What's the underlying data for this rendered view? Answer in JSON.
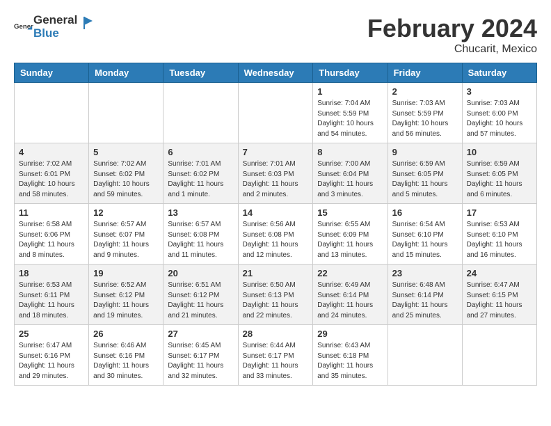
{
  "header": {
    "logo_general": "General",
    "logo_blue": "Blue",
    "month_year": "February 2024",
    "location": "Chucarit, Mexico"
  },
  "weekdays": [
    "Sunday",
    "Monday",
    "Tuesday",
    "Wednesday",
    "Thursday",
    "Friday",
    "Saturday"
  ],
  "weeks": [
    [
      {
        "day": "",
        "info": ""
      },
      {
        "day": "",
        "info": ""
      },
      {
        "day": "",
        "info": ""
      },
      {
        "day": "",
        "info": ""
      },
      {
        "day": "1",
        "info": "Sunrise: 7:04 AM\nSunset: 5:59 PM\nDaylight: 10 hours and 54 minutes."
      },
      {
        "day": "2",
        "info": "Sunrise: 7:03 AM\nSunset: 5:59 PM\nDaylight: 10 hours and 56 minutes."
      },
      {
        "day": "3",
        "info": "Sunrise: 7:03 AM\nSunset: 6:00 PM\nDaylight: 10 hours and 57 minutes."
      }
    ],
    [
      {
        "day": "4",
        "info": "Sunrise: 7:02 AM\nSunset: 6:01 PM\nDaylight: 10 hours and 58 minutes."
      },
      {
        "day": "5",
        "info": "Sunrise: 7:02 AM\nSunset: 6:02 PM\nDaylight: 10 hours and 59 minutes."
      },
      {
        "day": "6",
        "info": "Sunrise: 7:01 AM\nSunset: 6:02 PM\nDaylight: 11 hours and 1 minute."
      },
      {
        "day": "7",
        "info": "Sunrise: 7:01 AM\nSunset: 6:03 PM\nDaylight: 11 hours and 2 minutes."
      },
      {
        "day": "8",
        "info": "Sunrise: 7:00 AM\nSunset: 6:04 PM\nDaylight: 11 hours and 3 minutes."
      },
      {
        "day": "9",
        "info": "Sunrise: 6:59 AM\nSunset: 6:05 PM\nDaylight: 11 hours and 5 minutes."
      },
      {
        "day": "10",
        "info": "Sunrise: 6:59 AM\nSunset: 6:05 PM\nDaylight: 11 hours and 6 minutes."
      }
    ],
    [
      {
        "day": "11",
        "info": "Sunrise: 6:58 AM\nSunset: 6:06 PM\nDaylight: 11 hours and 8 minutes."
      },
      {
        "day": "12",
        "info": "Sunrise: 6:57 AM\nSunset: 6:07 PM\nDaylight: 11 hours and 9 minutes."
      },
      {
        "day": "13",
        "info": "Sunrise: 6:57 AM\nSunset: 6:08 PM\nDaylight: 11 hours and 11 minutes."
      },
      {
        "day": "14",
        "info": "Sunrise: 6:56 AM\nSunset: 6:08 PM\nDaylight: 11 hours and 12 minutes."
      },
      {
        "day": "15",
        "info": "Sunrise: 6:55 AM\nSunset: 6:09 PM\nDaylight: 11 hours and 13 minutes."
      },
      {
        "day": "16",
        "info": "Sunrise: 6:54 AM\nSunset: 6:10 PM\nDaylight: 11 hours and 15 minutes."
      },
      {
        "day": "17",
        "info": "Sunrise: 6:53 AM\nSunset: 6:10 PM\nDaylight: 11 hours and 16 minutes."
      }
    ],
    [
      {
        "day": "18",
        "info": "Sunrise: 6:53 AM\nSunset: 6:11 PM\nDaylight: 11 hours and 18 minutes."
      },
      {
        "day": "19",
        "info": "Sunrise: 6:52 AM\nSunset: 6:12 PM\nDaylight: 11 hours and 19 minutes."
      },
      {
        "day": "20",
        "info": "Sunrise: 6:51 AM\nSunset: 6:12 PM\nDaylight: 11 hours and 21 minutes."
      },
      {
        "day": "21",
        "info": "Sunrise: 6:50 AM\nSunset: 6:13 PM\nDaylight: 11 hours and 22 minutes."
      },
      {
        "day": "22",
        "info": "Sunrise: 6:49 AM\nSunset: 6:14 PM\nDaylight: 11 hours and 24 minutes."
      },
      {
        "day": "23",
        "info": "Sunrise: 6:48 AM\nSunset: 6:14 PM\nDaylight: 11 hours and 25 minutes."
      },
      {
        "day": "24",
        "info": "Sunrise: 6:47 AM\nSunset: 6:15 PM\nDaylight: 11 hours and 27 minutes."
      }
    ],
    [
      {
        "day": "25",
        "info": "Sunrise: 6:47 AM\nSunset: 6:16 PM\nDaylight: 11 hours and 29 minutes."
      },
      {
        "day": "26",
        "info": "Sunrise: 6:46 AM\nSunset: 6:16 PM\nDaylight: 11 hours and 30 minutes."
      },
      {
        "day": "27",
        "info": "Sunrise: 6:45 AM\nSunset: 6:17 PM\nDaylight: 11 hours and 32 minutes."
      },
      {
        "day": "28",
        "info": "Sunrise: 6:44 AM\nSunset: 6:17 PM\nDaylight: 11 hours and 33 minutes."
      },
      {
        "day": "29",
        "info": "Sunrise: 6:43 AM\nSunset: 6:18 PM\nDaylight: 11 hours and 35 minutes."
      },
      {
        "day": "",
        "info": ""
      },
      {
        "day": "",
        "info": ""
      }
    ]
  ]
}
